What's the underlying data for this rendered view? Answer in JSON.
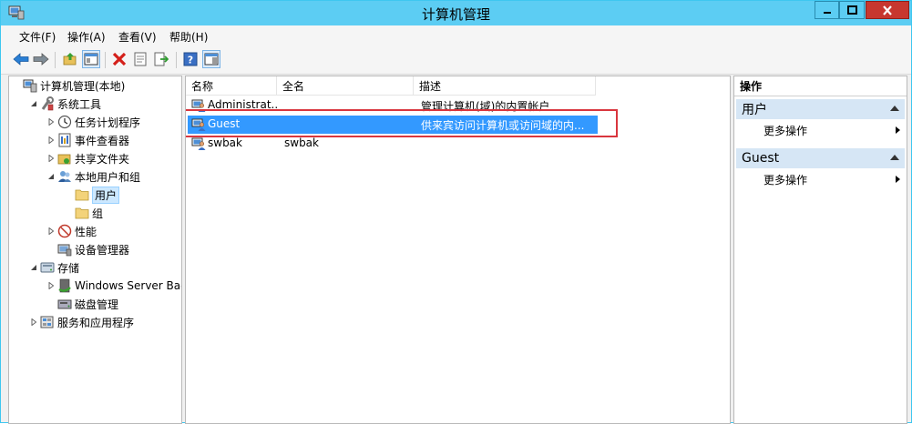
{
  "window": {
    "title": "计算机管理"
  },
  "menu": [
    {
      "label": "文件(F)"
    },
    {
      "label": "操作(A)"
    },
    {
      "label": "查看(V)"
    },
    {
      "label": "帮助(H)"
    }
  ],
  "toolbar_icons": [
    "back-icon",
    "forward-icon",
    "up-folder-icon",
    "show-hide-console-tree-icon",
    "delete-icon",
    "properties-icon",
    "export-list-icon",
    "help-icon",
    "show-hide-action-pane-icon"
  ],
  "tree": [
    {
      "label": "计算机管理(本地)",
      "level": 0,
      "expander": "",
      "icon": "computer-management-icon"
    },
    {
      "label": "系统工具",
      "level": 1,
      "expander": "expanded",
      "icon": "system-tools-icon"
    },
    {
      "label": "任务计划程序",
      "level": 2,
      "expander": "collapsed",
      "icon": "task-scheduler-icon"
    },
    {
      "label": "事件查看器",
      "level": 2,
      "expander": "collapsed",
      "icon": "event-viewer-icon"
    },
    {
      "label": "共享文件夹",
      "level": 2,
      "expander": "collapsed",
      "icon": "shared-folders-icon"
    },
    {
      "label": "本地用户和组",
      "level": 2,
      "expander": "expanded",
      "icon": "local-users-groups-icon"
    },
    {
      "label": "用户",
      "level": 3,
      "expander": "",
      "icon": "folder-icon",
      "selected": true
    },
    {
      "label": "组",
      "level": 3,
      "expander": "",
      "icon": "folder-icon"
    },
    {
      "label": "性能",
      "level": 2,
      "expander": "collapsed",
      "icon": "performance-icon"
    },
    {
      "label": "设备管理器",
      "level": 2,
      "expander": "",
      "icon": "device-manager-icon"
    },
    {
      "label": "存储",
      "level": 1,
      "expander": "expanded",
      "icon": "storage-icon"
    },
    {
      "label": "Windows Server Back",
      "level": 2,
      "expander": "collapsed",
      "icon": "windows-server-backup-icon"
    },
    {
      "label": "磁盘管理",
      "level": 2,
      "expander": "",
      "icon": "disk-management-icon"
    },
    {
      "label": "服务和应用程序",
      "level": 1,
      "expander": "collapsed",
      "icon": "services-applications-icon"
    }
  ],
  "list": {
    "columns": [
      "名称",
      "全名",
      "描述"
    ],
    "rows": [
      {
        "name": "Administrat...",
        "fullname": "",
        "description": "管理计算机(域)的内置帐户"
      },
      {
        "name": "Guest",
        "fullname": "",
        "description": "供来宾访问计算机或访问域的内...",
        "selected": true
      },
      {
        "name": "swbak",
        "fullname": "swbak",
        "description": ""
      }
    ]
  },
  "actions": {
    "title": "操作",
    "sections": [
      {
        "header": "用户",
        "items": [
          "更多操作"
        ]
      },
      {
        "header": "Guest",
        "items": [
          "更多操作"
        ]
      }
    ]
  },
  "colors": {
    "titlebar": "#5ccdf3",
    "close_button": "#c7372f",
    "selection": "#3399ff",
    "highlight_box": "#d9363e",
    "section_header": "#d6e6f5"
  }
}
